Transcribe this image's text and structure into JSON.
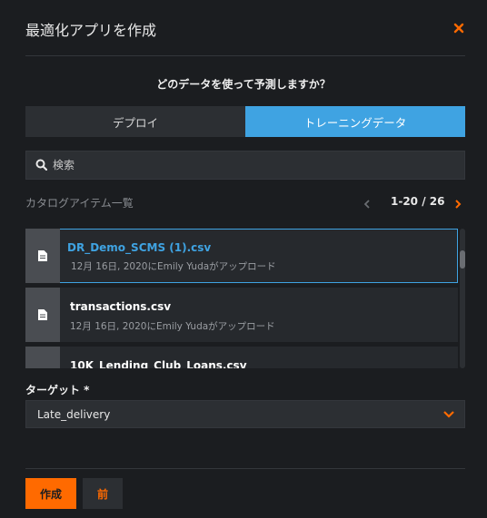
{
  "dialog": {
    "title": "最適化アプリを作成",
    "close_icon": "close-icon",
    "accent_color": "#ff6a00",
    "selected_color": "#3fa3e2"
  },
  "question": "どのデータを使って予測しますか？",
  "tabs": [
    {
      "label": "デプロイ",
      "active": false
    },
    {
      "label": "トレーニングデータ",
      "active": true
    }
  ],
  "search": {
    "placeholder": "検索",
    "value": "",
    "icon": "search-icon"
  },
  "catalog": {
    "label": "カタログアイテム一覧",
    "pager": {
      "range": "1-20 / 26",
      "prev_icon": "chevron-left-icon",
      "next_icon": "chevron-right-icon"
    },
    "items": [
      {
        "name": "DR_Demo_SCMS (1).csv",
        "meta": "12月 16日, 2020にEmily Yudaがアップロード",
        "selected": true,
        "icon": "file-icon"
      },
      {
        "name": "transactions.csv",
        "meta": "12月 16日, 2020にEmily Yudaがアップロード",
        "selected": false,
        "icon": "file-icon"
      },
      {
        "name": "10K_Lending_Club_Loans.csv",
        "meta": "",
        "selected": false,
        "icon": "file-icon"
      }
    ]
  },
  "target": {
    "label": "ターゲット *",
    "value": "Late_delivery",
    "icon": "chevron-down-icon"
  },
  "footer": {
    "create_label": "作成",
    "back_label": "前"
  }
}
